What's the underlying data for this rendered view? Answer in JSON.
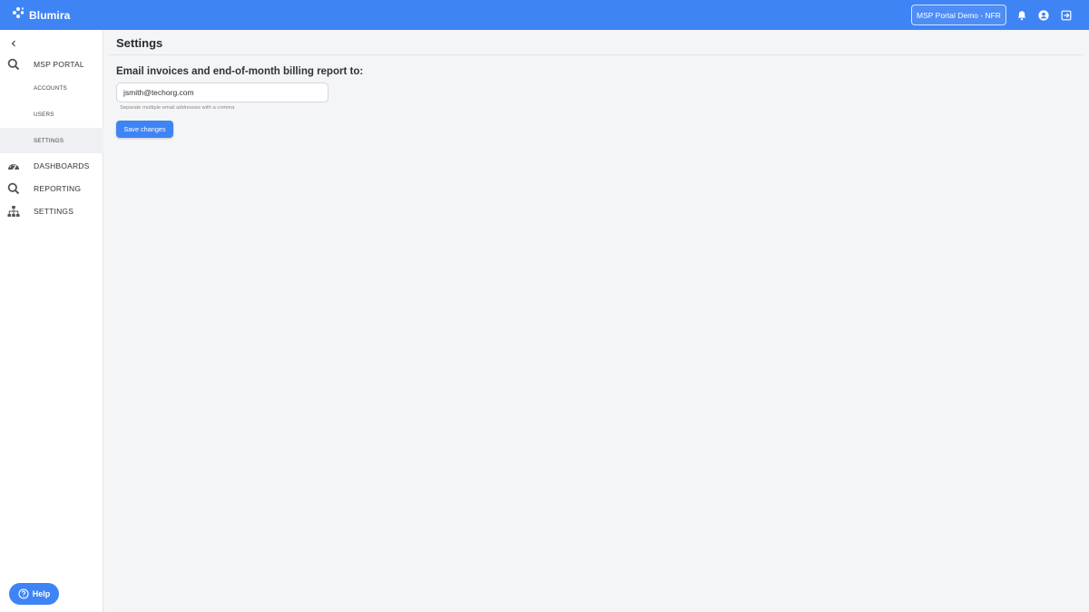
{
  "brand": {
    "name": "Blumira",
    "accent": "#3f84f5"
  },
  "header": {
    "org_switcher": "MSP Portal Demo - NFR",
    "icons": [
      "bell-icon",
      "user-account-icon",
      "logout-icon"
    ]
  },
  "sidebar": {
    "msp_portal": "MSP PORTAL",
    "sub_items": [
      {
        "label": "ACCOUNTS"
      },
      {
        "label": "USERS"
      },
      {
        "label": "SETTINGS",
        "active": true
      }
    ],
    "sections": [
      {
        "label": "DASHBOARDS",
        "icon": "dashboard-gauge-icon"
      },
      {
        "label": "REPORTING",
        "icon": "search-icon"
      },
      {
        "label": "SETTINGS",
        "icon": "sitemap-icon"
      }
    ],
    "help": "Help"
  },
  "main": {
    "title": "Settings",
    "email_label": "Email invoices and end-of-month billing report to:",
    "email_value": "jsmith@techorg.com",
    "hint": "Separate multiple email addresses with a comma",
    "save_label": "Save changes"
  }
}
